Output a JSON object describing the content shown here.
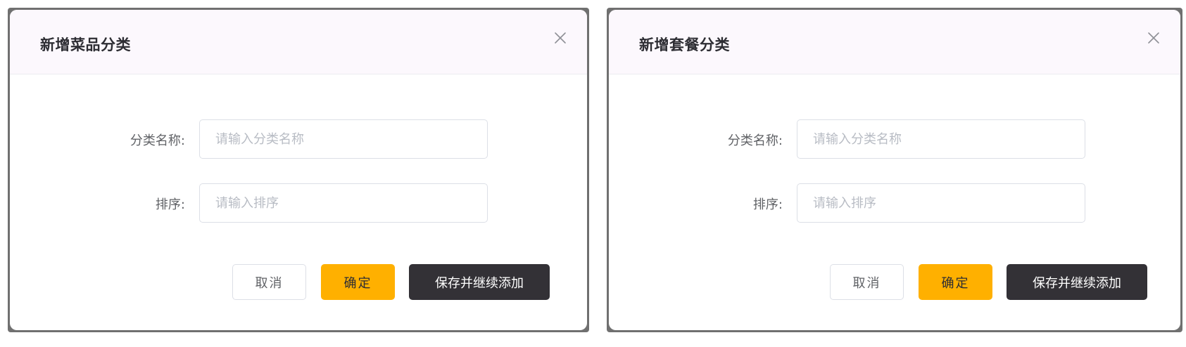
{
  "dialogs": [
    {
      "title": "新增菜品分类",
      "close_icon": "close-icon",
      "fields": {
        "name_label": "分类名称:",
        "name_placeholder": "请输入分类名称",
        "name_value": "",
        "sort_label": "排序:",
        "sort_placeholder": "请输入排序",
        "sort_value": ""
      },
      "buttons": {
        "cancel": "取消",
        "confirm": "确定",
        "save_continue": "保存并继续添加"
      }
    },
    {
      "title": "新增套餐分类",
      "close_icon": "close-icon",
      "fields": {
        "name_label": "分类名称:",
        "name_placeholder": "请输入分类名称",
        "name_value": "",
        "sort_label": "排序:",
        "sort_placeholder": "请输入排序",
        "sort_value": ""
      },
      "buttons": {
        "cancel": "取消",
        "confirm": "确定",
        "save_continue": "保存并继续添加"
      }
    }
  ],
  "colors": {
    "accent": "#ffb000",
    "dark_button": "#333136",
    "header_bg": "#fcf8fd",
    "frame": "#707070"
  }
}
